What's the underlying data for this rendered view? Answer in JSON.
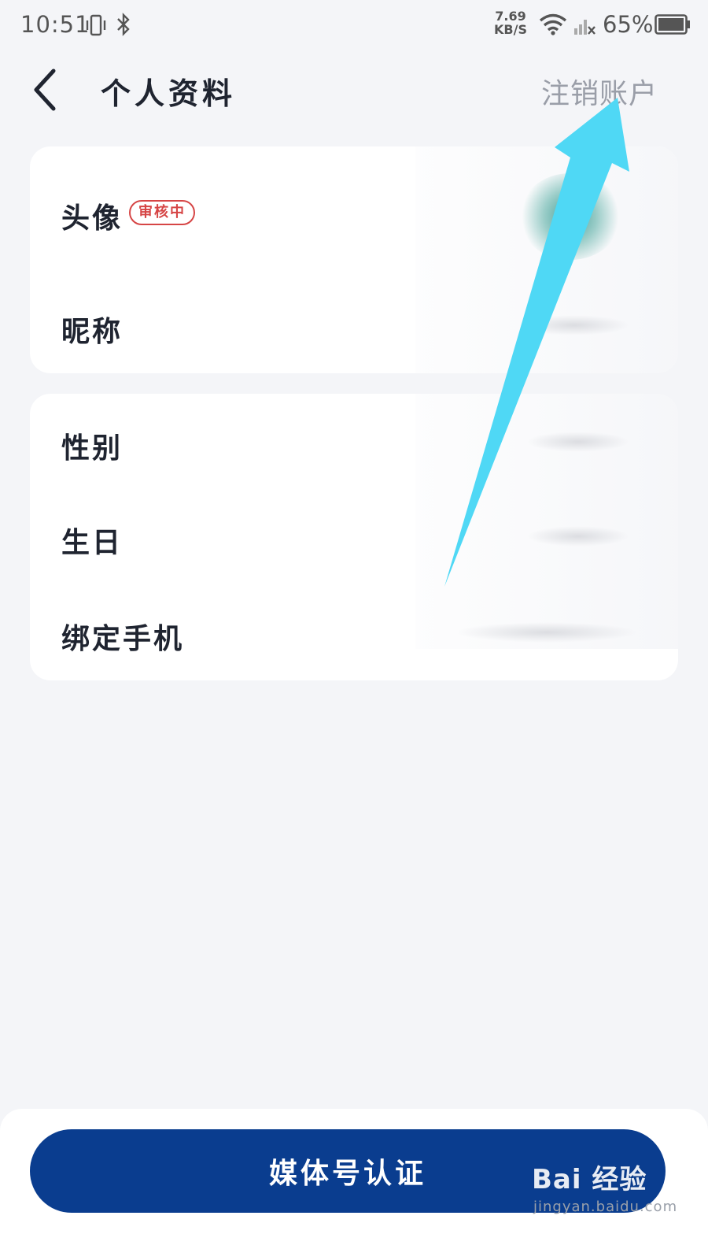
{
  "status_bar": {
    "time": "10:51",
    "net_speed_value": "7.69",
    "net_speed_unit": "KB/S",
    "battery_percent": "65%",
    "icons": [
      "vibrate-icon",
      "bluetooth-icon",
      "wifi-icon",
      "cell-signal-icon",
      "battery-icon"
    ]
  },
  "header": {
    "title": "个人资料",
    "cancel_account_label": "注销账户"
  },
  "card_basic": {
    "avatar_label": "头像",
    "avatar_status_badge": "审核中",
    "nickname_label": "昵称"
  },
  "card_info": {
    "gender_label": "性别",
    "birthday_label": "生日",
    "bind_phone_label": "绑定手机"
  },
  "footer": {
    "media_cert_button": "媒体号认证"
  },
  "watermark": {
    "brand": "Bai 经验",
    "url": "jingyan.baidu.com"
  },
  "colors": {
    "primary_button": "#0a3d8f",
    "badge": "#d64545",
    "annotation_arrow": "#4fd8f5",
    "background": "#f4f5f8"
  }
}
